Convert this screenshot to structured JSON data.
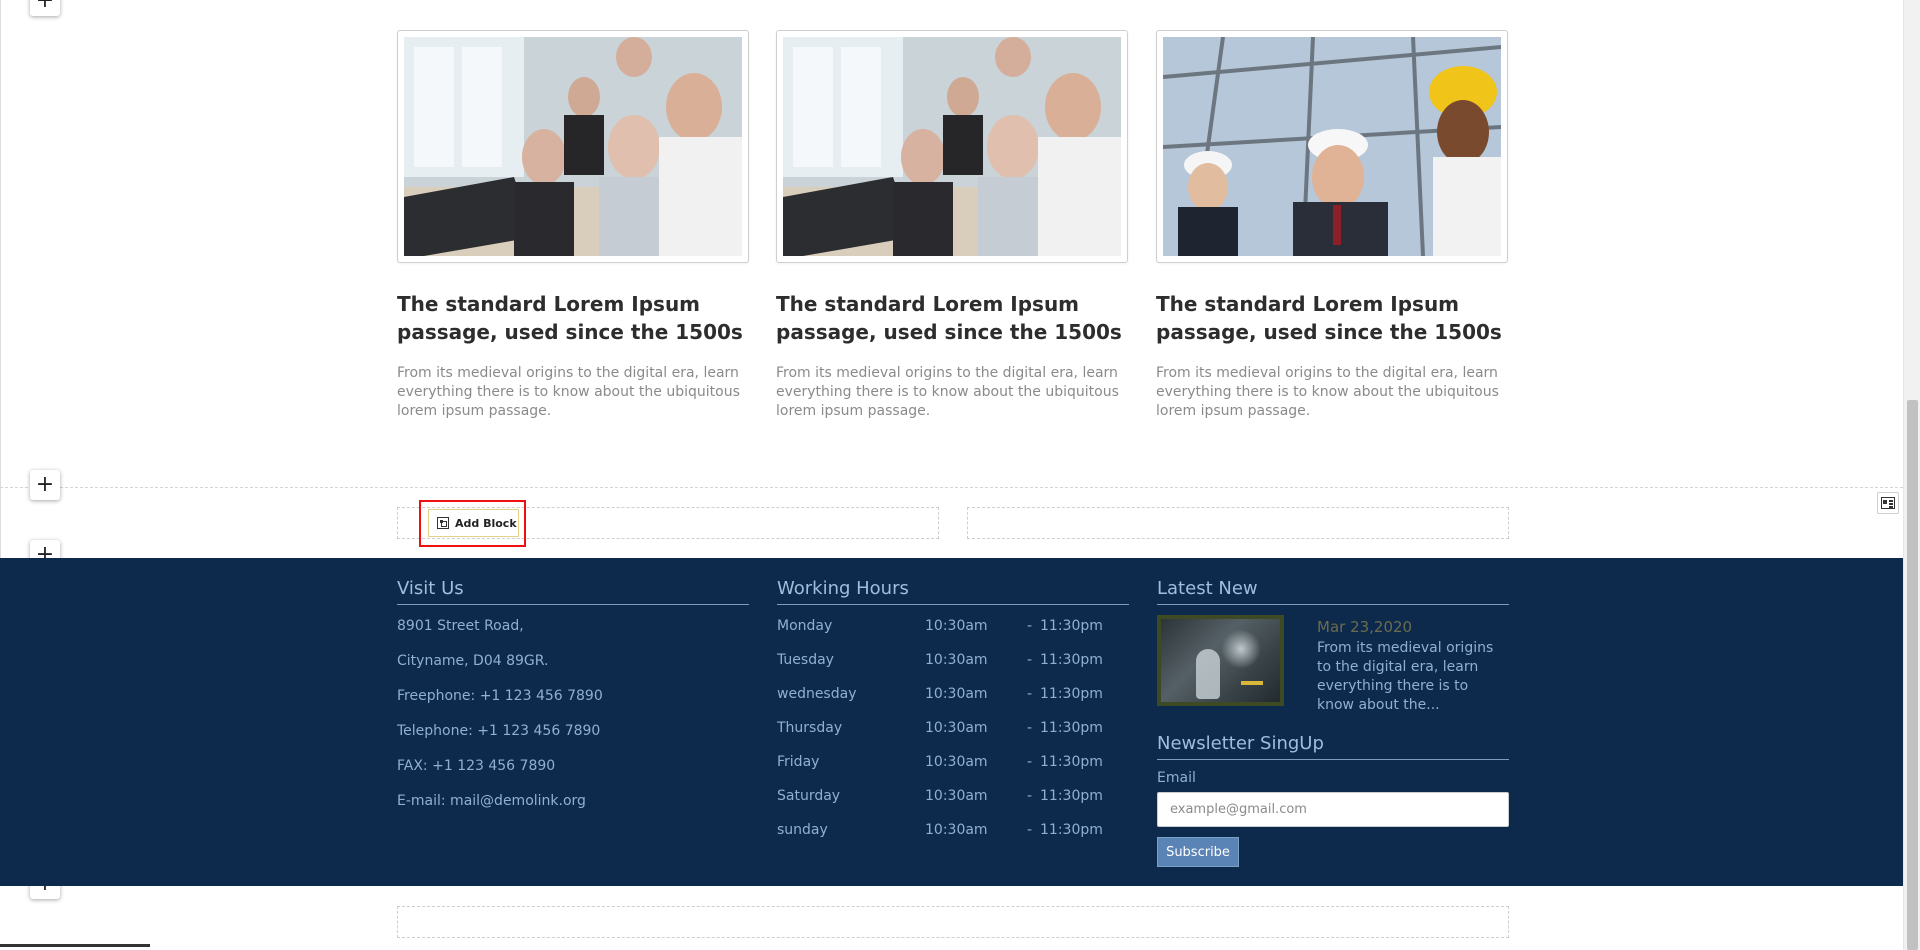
{
  "cards": [
    {
      "title": "The standard Lorem Ipsum passage, used since the 1500s",
      "text": "From its medieval origins to the digital era, learn everything there is to know about the ubiquitous lorem ipsum passage."
    },
    {
      "title": "The standard Lorem Ipsum passage, used since the 1500s",
      "text": "From its medieval origins to the digital era, learn everything there is to know about the ubiquitous lorem ipsum passage."
    },
    {
      "title": "The standard Lorem Ipsum passage, used since the 1500s",
      "text": "From its medieval origins to the digital era, learn everything there is to know about the ubiquitous lorem ipsum passage."
    }
  ],
  "editor": {
    "add_block_label": "Add Block",
    "plus_symbol": "+"
  },
  "footer": {
    "visit": {
      "title": "Visit Us",
      "lines": [
        "8901 Street Road,",
        "Cityname, D04 89GR.",
        "Freephone: +1 123 456 7890",
        "Telephone: +1 123 456 7890",
        "FAX: +1 123 456 7890",
        "E-mail: mail@demolink.org"
      ]
    },
    "hours": {
      "title": "Working Hours",
      "rows": [
        {
          "day": "Monday",
          "open": "10:30am",
          "dash": "-",
          "close": "11:30pm"
        },
        {
          "day": "Tuesday",
          "open": "10:30am",
          "dash": "-",
          "close": "11:30pm"
        },
        {
          "day": "wednesday",
          "open": "10:30am",
          "dash": "-",
          "close": "11:30pm"
        },
        {
          "day": "Thursday",
          "open": "10:30am",
          "dash": "-",
          "close": "11:30pm"
        },
        {
          "day": "Friday",
          "open": "10:30am",
          "dash": "-",
          "close": "11:30pm"
        },
        {
          "day": "Saturday",
          "open": "10:30am",
          "dash": "-",
          "close": "11:30pm"
        },
        {
          "day": "sunday",
          "open": "10:30am",
          "dash": "-",
          "close": "11:30pm"
        }
      ]
    },
    "latest": {
      "title": "Latest New",
      "date": "Mar 23,2020",
      "text": "From its medieval origins to the digital era, learn everything there is to know about the..."
    },
    "newsletter": {
      "title": "Newsletter SingUp",
      "email_label": "Email",
      "email_placeholder": "example@gmail.com",
      "subscribe_label": "Subscribe"
    }
  },
  "colors": {
    "footer_bg": "#0d2a4c",
    "footer_text": "#8fb0d3",
    "subscribe_bg": "#5b84b6",
    "highlight": "#ee1111"
  }
}
